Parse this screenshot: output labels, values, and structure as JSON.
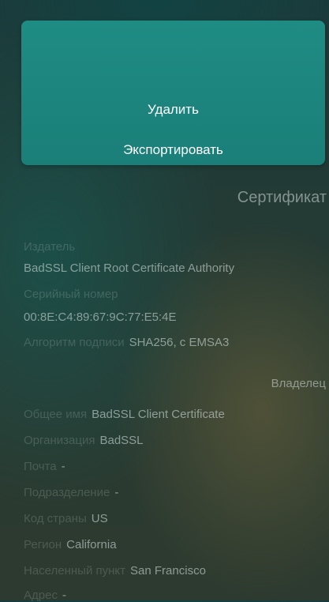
{
  "actions": {
    "delete_label": "Удалить",
    "export_label": "Экспортировать"
  },
  "certificate": {
    "section_title": "Сертификат",
    "issuer_label": "Издатель",
    "issuer_value": "BadSSL Client Root Certificate Authority",
    "serial_label": "Серийный номер",
    "serial_value": "00:8E:C4:89:67:9C:77:E5:4E",
    "algorithm_label": "Алгоритм подписи",
    "algorithm_value": "SHA256, с EMSA3"
  },
  "owner": {
    "section_title": "Владелец",
    "common_name_label": "Общее имя",
    "common_name_value": "BadSSL Client Certificate",
    "organization_label": "Организация",
    "organization_value": "BadSSL",
    "email_label": "Почта",
    "email_value": "-",
    "unit_label": "Подразделение",
    "unit_value": "-",
    "country_label": "Код страны",
    "country_value": "US",
    "region_label": "Регион",
    "region_value": "California",
    "locality_label": "Населенный пункт",
    "locality_value": "San Francisco",
    "address_label": "Адрес",
    "address_value": "-"
  }
}
